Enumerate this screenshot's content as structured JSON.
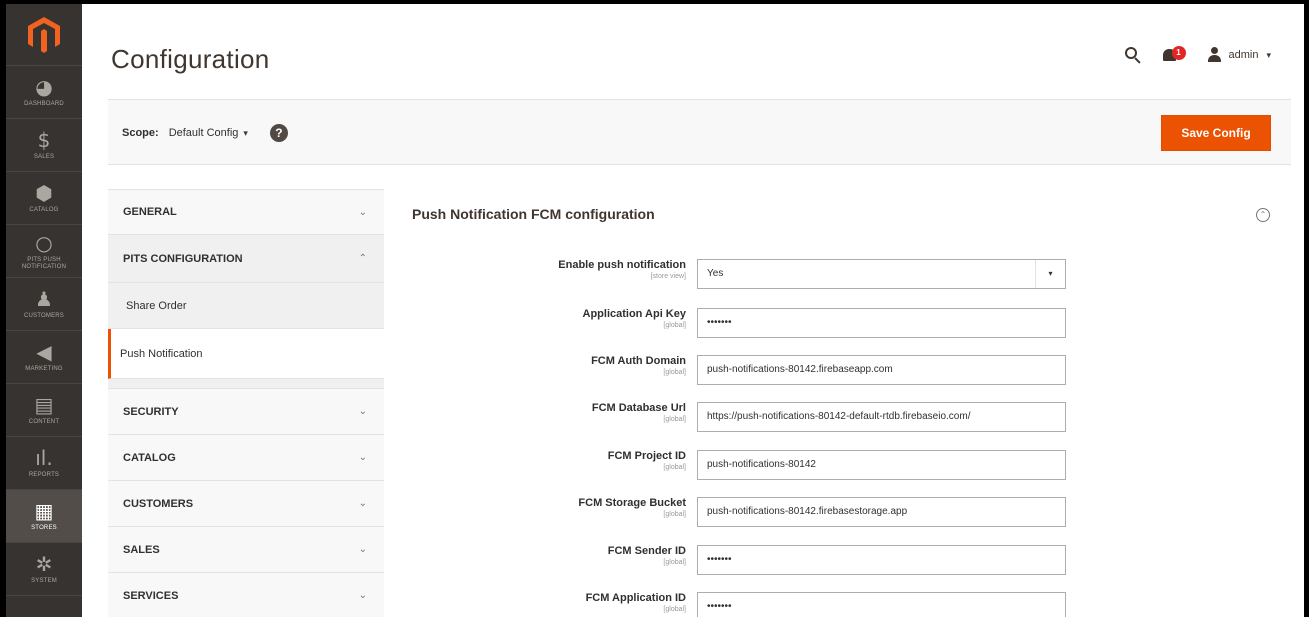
{
  "nav": {
    "items": [
      {
        "icon": "dashboard-icon",
        "glyph": "◕",
        "label": "Dashboard"
      },
      {
        "icon": "dollar-icon",
        "glyph": "$",
        "label": "Sales"
      },
      {
        "icon": "cube-icon",
        "glyph": "⬢",
        "label": "Catalog"
      },
      {
        "icon": "circle-icon",
        "glyph": "○",
        "label": "PITS Push Notification"
      },
      {
        "icon": "person-icon",
        "glyph": "♟",
        "label": "Customers"
      },
      {
        "icon": "megaphone-icon",
        "glyph": "◀",
        "label": "Marketing"
      },
      {
        "icon": "content-icon",
        "glyph": "▤",
        "label": "Content"
      },
      {
        "icon": "reports-icon",
        "glyph": "ıl.",
        "label": "Reports"
      },
      {
        "icon": "store-icon",
        "glyph": "▦",
        "label": "Stores"
      },
      {
        "icon": "gear-icon",
        "glyph": "✲",
        "label": "System"
      }
    ]
  },
  "header": {
    "title": "Configuration",
    "notifications_count": "1",
    "user": "admin"
  },
  "scope": {
    "label": "Scope:",
    "value": "Default Config",
    "help": "?"
  },
  "actions": {
    "save": "Save Config"
  },
  "tabs": [
    {
      "title": "GENERAL",
      "open": false
    },
    {
      "title": "PITS CONFIGURATION",
      "open": true,
      "items": [
        "Share Order",
        "Push Notification"
      ]
    },
    {
      "title": "SECURITY",
      "open": false
    },
    {
      "title": "CATALOG",
      "open": false
    },
    {
      "title": "CUSTOMERS",
      "open": false
    },
    {
      "title": "SALES",
      "open": false
    },
    {
      "title": "SERVICES",
      "open": false
    }
  ],
  "section": {
    "title": "Push Notification FCM configuration"
  },
  "fields": [
    {
      "label": "Enable push notification",
      "scope": "[store view]",
      "value": "Yes",
      "type": "select"
    },
    {
      "label": "Application Api Key",
      "scope": "[global]",
      "value": "•••••••",
      "type": "password"
    },
    {
      "label": "FCM Auth Domain",
      "scope": "[global]",
      "value": "push-notifications-80142.firebaseapp.com",
      "type": "text"
    },
    {
      "label": "FCM Database Url",
      "scope": "[global]",
      "value": "https://push-notifications-80142-default-rtdb.firebaseio.com/",
      "type": "text"
    },
    {
      "label": "FCM Project ID",
      "scope": "[global]",
      "value": "push-notifications-80142",
      "type": "text"
    },
    {
      "label": "FCM Storage Bucket",
      "scope": "[global]",
      "value": "push-notifications-80142.firebasestorage.app",
      "type": "text"
    },
    {
      "label": "FCM Sender ID",
      "scope": "[global]",
      "value": "•••••••",
      "type": "password"
    },
    {
      "label": "FCM Application ID",
      "scope": "[global]",
      "value": "•••••••",
      "type": "password"
    }
  ]
}
